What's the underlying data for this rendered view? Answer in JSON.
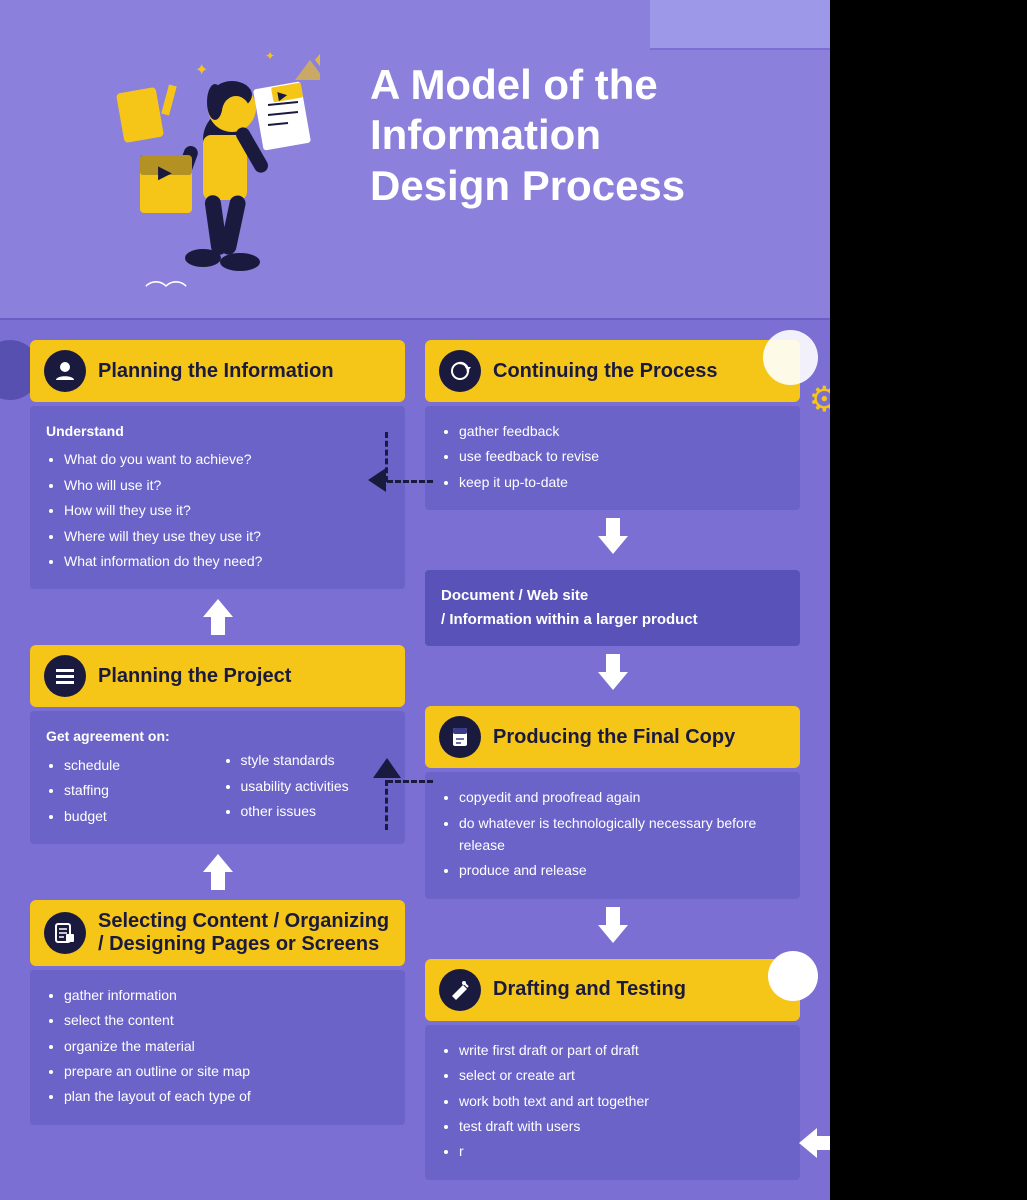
{
  "page": {
    "background_color": "#7B6FD4",
    "title": "A Model of the Information Design Process"
  },
  "header": {
    "title_line1": "A Model of the",
    "title_line2": "Information",
    "title_line3": "Design Process"
  },
  "steps": {
    "planning_info": {
      "title": "Planning the Information",
      "icon": "👤",
      "understand_label": "Understand",
      "bullets": [
        "What do you want to achieve?",
        "Who will use it?",
        "How will they use it?",
        "Where will they use they use it?",
        "What information do they need?"
      ]
    },
    "planning_project": {
      "title": "Planning the Project",
      "icon": "≡",
      "get_agreement_label": "Get agreement on:",
      "col1_bullets": [
        "schedule",
        "staffing",
        "budget"
      ],
      "col2_bullets": [
        "style standards",
        "usability activities",
        "other issues"
      ]
    },
    "selecting_content": {
      "title": "Selecting Content / Organizing / Designing Pages or Screens",
      "icon": "📋",
      "bullets": [
        "gather information",
        "select the content",
        "organize the material",
        "prepare an outline or site map",
        "plan the layout of each type of"
      ]
    },
    "continuing": {
      "title": "Continuing the Process",
      "icon": "🔄",
      "bullets": [
        "gather feedback",
        "use feedback to revise",
        "keep it up-to-date"
      ]
    },
    "document_box": {
      "text_line1": "Document  /  Web site",
      "text_line2": "/  Information within a larger product"
    },
    "final_copy": {
      "title": "Producing the Final Copy",
      "icon": "📄",
      "bullets": [
        "copyedit and proofread again",
        "do whatever is technologically necessary before release",
        "produce and release"
      ]
    },
    "drafting": {
      "title": "Drafting and Testing",
      "icon": "✏️",
      "bullets": [
        "write first draft or part of draft",
        "select or create art",
        "work both text and art together",
        "test draft with users",
        "r"
      ]
    }
  },
  "arrows": {
    "down": "▼",
    "up": "▲",
    "right": "→"
  }
}
